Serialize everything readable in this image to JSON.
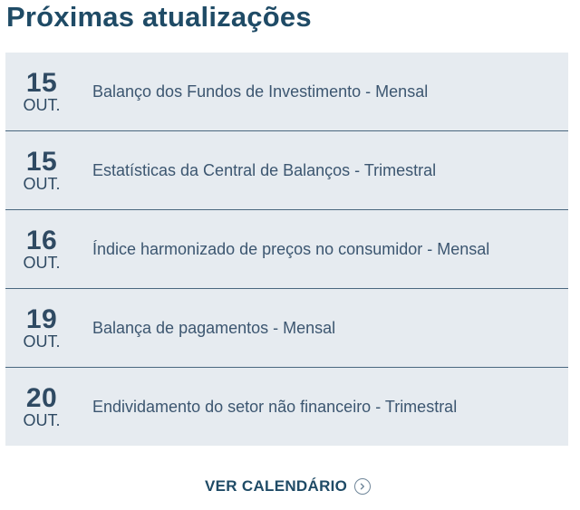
{
  "header": {
    "title": "Próximas atualizações"
  },
  "updates": [
    {
      "day": "15",
      "month": "OUT.",
      "label": "Balanço dos Fundos de Investimento - Mensal"
    },
    {
      "day": "15",
      "month": "OUT.",
      "label": "Estatísticas da Central de Balanços - Trimestral"
    },
    {
      "day": "16",
      "month": "OUT.",
      "label": "Índice harmonizado de preços no consumidor - Mensal"
    },
    {
      "day": "19",
      "month": "OUT.",
      "label": "Balança de pagamentos - Mensal"
    },
    {
      "day": "20",
      "month": "OUT.",
      "label": "Endividamento do setor não financeiro - Trimestral"
    }
  ],
  "footer": {
    "cta_label": "VER CALENDÁRIO",
    "cta_icon": "chevron-right-circle-icon"
  },
  "colors": {
    "background": "#ffffff",
    "list_background": "#e6ebf0",
    "title": "#1f4b66",
    "divider": "#4a677f",
    "text": "#3c5670"
  }
}
